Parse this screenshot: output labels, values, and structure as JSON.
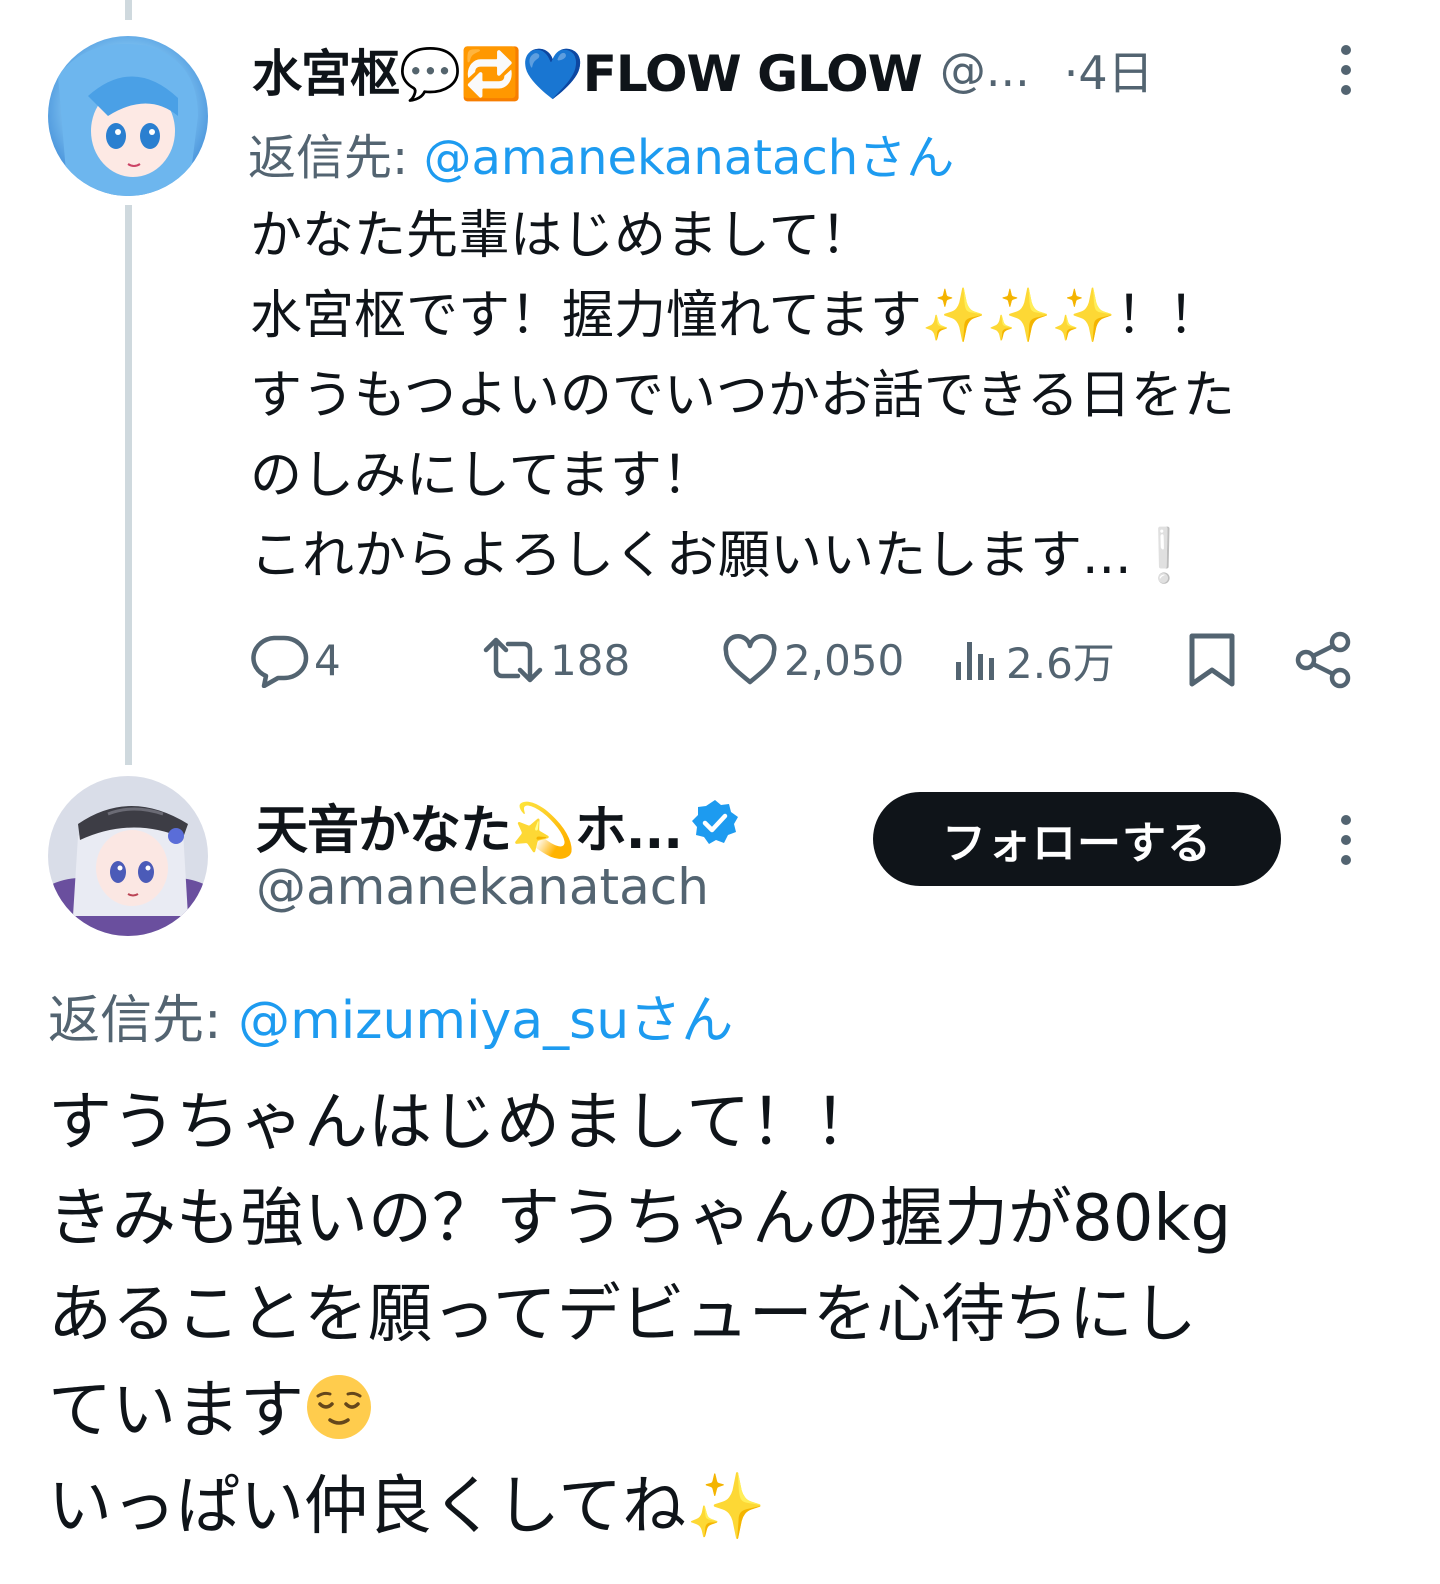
{
  "tweet1": {
    "author_name": "水宮枢💬🔁💙FLOW GLOW",
    "handle_truncated": "@...",
    "date": "·4日",
    "reply_label": "返信先: ",
    "reply_mention": "@amanekanatachさん",
    "body": "かなた先輩はじめまして！\n水宮枢です！握力憧れてます✨✨✨！！\nすうもつよいのでいつかお話できる日をた\nのしみにしてます！\nこれからよろしくお願いいたします...❕",
    "actions": {
      "replies": "4",
      "reposts": "188",
      "likes": "2,050",
      "views": "2.6万"
    },
    "icons": {
      "reply": "reply-icon",
      "repost": "repost-icon",
      "like": "heart-icon",
      "views": "views-icon",
      "bookmark": "bookmark-icon",
      "share": "share-icon",
      "more": "more-dots-icon"
    }
  },
  "tweet2": {
    "author_name": "天音かなた💫ホ...",
    "handle": "@amanekanatach",
    "follow_label": "フォローする",
    "reply_label": "返信先: ",
    "reply_mention": "@mizumiya_suさん",
    "body_lines": [
      "すうちゃんはじめまして！！",
      "きみも強いの？すうちゃんの握力が80kg",
      "あることを願ってデビューを心待ちにし",
      "ています",
      "いっぱい仲良くしてね✨"
    ],
    "verified_icon": "verified-badge-icon"
  },
  "colors": {
    "text": "#0f1419",
    "secondary": "#536471",
    "accent": "#1d9bf0",
    "thread_line": "#cfd9de",
    "button_bg": "#0f1419"
  }
}
